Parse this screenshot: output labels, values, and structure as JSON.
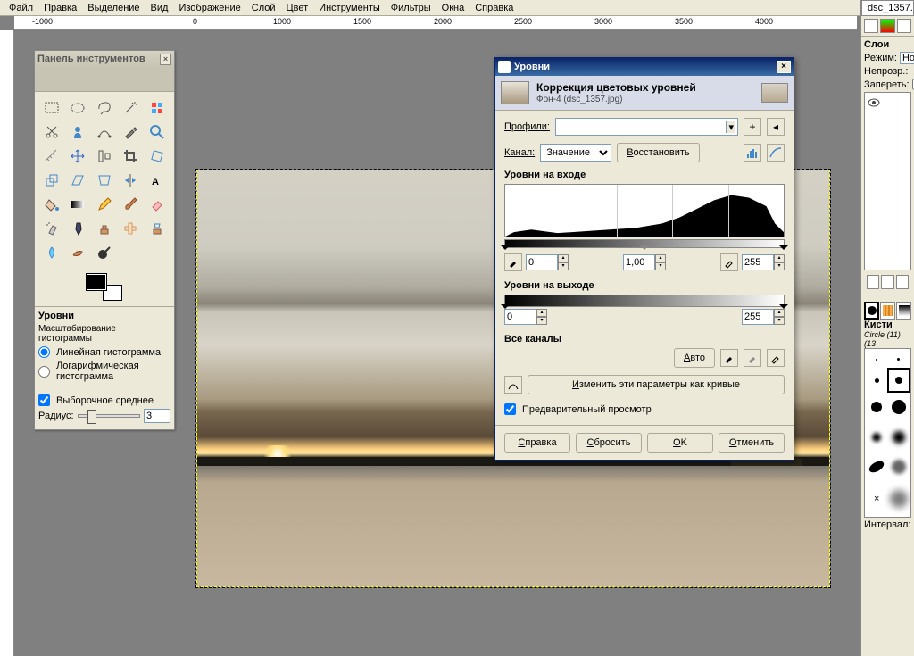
{
  "menu": [
    "Файл",
    "Правка",
    "Выделение",
    "Вид",
    "Изображение",
    "Слой",
    "Цвет",
    "Инструменты",
    "Фильтры",
    "Окна",
    "Справка"
  ],
  "ruler_ticks": [
    "-1000",
    "0",
    "1000",
    "1500",
    "2000",
    "2500",
    "3000",
    "3500",
    "4000"
  ],
  "toolbox": {
    "title": "Панель инструментов"
  },
  "tool_options": {
    "title": "Уровни",
    "hist_label": "Масштабирование гистограммы",
    "radio_linear": "Линейная гистограмма",
    "radio_log": "Логарифмическая гистограмма",
    "check_sample": "Выборочное среднее",
    "radius_label": "Радиус:",
    "radius_value": "3"
  },
  "levels": {
    "win_title": "Уровни",
    "title": "Коррекция цветовых уровней",
    "subtitle": "Фон-4 (dsc_1357.jpg)",
    "profile_label": "Профили:",
    "channel_label": "Канал:",
    "channel_value": "Значение",
    "reset_channel": "Восстановить",
    "input_label": "Уровни на входе",
    "in_low": "0",
    "in_gamma": "1,00",
    "in_high": "255",
    "output_label": "Уровни на выходе",
    "out_low": "0",
    "out_high": "255",
    "all_label": "Все каналы",
    "auto": "Авто",
    "curves_btn": "Изменить эти параметры как кривые",
    "preview": "Предварительный просмотр",
    "help": "Справка",
    "reset": "Сбросить",
    "ok": "OK",
    "cancel": "Отменить"
  },
  "right": {
    "doc_tab": "dsc_1357.",
    "layers_title": "Слои",
    "mode_label": "Режим:",
    "mode_value": "Нор",
    "opacity_label": "Непрозр.:",
    "lock_label": "Запереть:",
    "brushes_title": "Кисти",
    "brush_name": "Circle (11) (13",
    "interval_label": "Интервал:"
  }
}
